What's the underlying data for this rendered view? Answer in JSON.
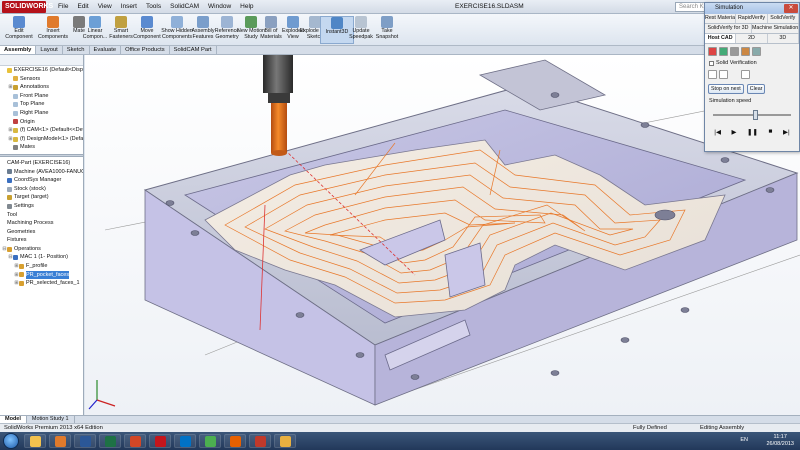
{
  "app": {
    "logo_text": "SOLIDWORKS",
    "window_title": "EXERCISE16.SLDASM",
    "search_placeholder": "Search Kno"
  },
  "menus": [
    "File",
    "Edit",
    "View",
    "Insert",
    "Tools",
    "SolidCAM",
    "Window",
    "Help"
  ],
  "ribbon": {
    "buttons": [
      {
        "label": "Edit Component",
        "color": "#5a8ad0"
      },
      {
        "label": "Insert Components",
        "color": "#e07a2c"
      },
      {
        "label": "Mate",
        "color": "#7a7a7a"
      },
      {
        "label": "Linear Compon...",
        "color": "#6c9fd6"
      },
      {
        "label": "Smart Fasteners",
        "color": "#c0a040"
      },
      {
        "label": "Move Component",
        "color": "#5a8ad0"
      },
      {
        "label": "Show Hidden Components",
        "color": "#8fb0d8"
      },
      {
        "label": "Assembly Features",
        "color": "#7a9ecb"
      },
      {
        "label": "Reference Geometry",
        "color": "#9cb4d4"
      },
      {
        "label": "New Motion Study",
        "color": "#5b9b5b"
      },
      {
        "label": "Bill of Materials",
        "color": "#8aa0c0"
      },
      {
        "label": "Exploded View",
        "color": "#6f9bd0"
      },
      {
        "label": "Explode Line Sketch",
        "color": "#a5b8cf"
      },
      {
        "label": "Instant3D",
        "color": "#4f86c6"
      },
      {
        "label": "Update Speedpak",
        "color": "#b8c4d2"
      },
      {
        "label": "Take Snapshot",
        "color": "#7e9ec6"
      }
    ]
  },
  "tabs": [
    "Assembly",
    "Layout",
    "Sketch",
    "Evaluate",
    "Office Products",
    "SolidCAM Part"
  ],
  "feature_tree": [
    {
      "label": "EXERCISE16  (Default<Display S",
      "color": "#e8c13a",
      "exp": "",
      "indent": 0
    },
    {
      "label": "Sensors",
      "color": "#e0b040",
      "exp": "",
      "indent": 1
    },
    {
      "label": "Annotations",
      "color": "#c8a030",
      "exp": "+",
      "indent": 1
    },
    {
      "label": "Front Plane",
      "color": "#a8c0d8",
      "exp": "",
      "indent": 1
    },
    {
      "label": "Top Plane",
      "color": "#a8c0d8",
      "exp": "",
      "indent": 1
    },
    {
      "label": "Right Plane",
      "color": "#a8c0d8",
      "exp": "",
      "indent": 1
    },
    {
      "label": "Origin",
      "color": "#c04040",
      "exp": "",
      "indent": 1
    },
    {
      "label": "(f) CAM<1> (Default<<Def",
      "color": "#d8b840",
      "exp": "+",
      "indent": 1
    },
    {
      "label": "(f) DesignModel<1> (Default",
      "color": "#d8b840",
      "exp": "+",
      "indent": 1
    },
    {
      "label": "Mates",
      "color": "#808080",
      "exp": "",
      "indent": 1
    }
  ],
  "cam_tree": [
    {
      "label": "CAM-Part (EXERCISE16)",
      "color": "",
      "exp": "",
      "indent": 0,
      "selected": false
    },
    {
      "label": "Machine (AVEA1000-FANUC)",
      "color": "#6a7c90",
      "exp": "",
      "indent": 0,
      "selected": false
    },
    {
      "label": "CoordSys Manager",
      "color": "#3a6fc0",
      "exp": "",
      "indent": 0,
      "selected": false
    },
    {
      "label": "Stock (stock)",
      "color": "#9aa8b8",
      "exp": "",
      "indent": 0,
      "selected": false
    },
    {
      "label": "Target (target)",
      "color": "#c8a030",
      "exp": "",
      "indent": 0,
      "selected": false
    },
    {
      "label": "Settings",
      "color": "#808890",
      "exp": "",
      "indent": 0,
      "selected": false
    },
    {
      "label": "Tool",
      "color": "",
      "exp": "",
      "indent": 0,
      "selected": false
    },
    {
      "label": "Machining Process",
      "color": "",
      "exp": "",
      "indent": 0,
      "selected": false
    },
    {
      "label": "Geometries",
      "color": "",
      "exp": "",
      "indent": 0,
      "selected": false
    },
    {
      "label": "Fixtures",
      "color": "",
      "exp": "",
      "indent": 0,
      "selected": false
    },
    {
      "label": "Operations",
      "color": "#d8a030",
      "exp": "-",
      "indent": 0,
      "selected": false
    },
    {
      "label": "MAC 1 (1- Position)",
      "color": "#3a6fc0",
      "exp": "-",
      "indent": 1,
      "selected": false
    },
    {
      "label": "F_profile",
      "color": "#d8a030",
      "exp": "+",
      "indent": 2,
      "selected": false
    },
    {
      "label": "PR_pocket_faces",
      "color": "#d8a030",
      "exp": "+",
      "indent": 2,
      "selected": true
    },
    {
      "label": "PR_selected_faces_1",
      "color": "#d8a030",
      "exp": "+",
      "indent": 2,
      "selected": false
    }
  ],
  "model_tabs": [
    "Model",
    "Motion Study 1"
  ],
  "status": {
    "edition": "SolidWorks Premium 2013 x64 Edition",
    "defined": "Fully Defined",
    "mode": "Editing Assembly"
  },
  "taskbar": {
    "apps": [
      {
        "name": "explorer",
        "color": "#f2c14e"
      },
      {
        "name": "media-player",
        "color": "#e07a2c"
      },
      {
        "name": "word",
        "color": "#2b5797"
      },
      {
        "name": "excel",
        "color": "#1e7145"
      },
      {
        "name": "powerpoint",
        "color": "#d24726"
      },
      {
        "name": "acrobat",
        "color": "#c4161c"
      },
      {
        "name": "outlook",
        "color": "#0072c6"
      },
      {
        "name": "chrome",
        "color": "#4caf50"
      },
      {
        "name": "firefox",
        "color": "#e66000"
      },
      {
        "name": "solidworks",
        "color": "#c0392b"
      },
      {
        "name": "folder",
        "color": "#e8b040"
      }
    ],
    "lang": "EN",
    "time": "11:17",
    "date": "26/08/2013"
  },
  "simulation": {
    "title": "Simulation",
    "tabs_row1": [
      "Rest Material",
      "RapidVerify",
      "SolidVerify"
    ],
    "tabs_row2": [
      "SolidVerify for 3D",
      "Machine Simulation"
    ],
    "tabs_row3": [
      "Host CAD",
      "2D",
      "3D"
    ],
    "active_tab": "Host CAD",
    "solid_verification_label": "Solid Verification",
    "stop_on_next_label": "Stop on next",
    "clear_label": "Clear",
    "speed_label": "Simulation speed",
    "speed_level": 0.55,
    "close_glyph": "✕"
  }
}
